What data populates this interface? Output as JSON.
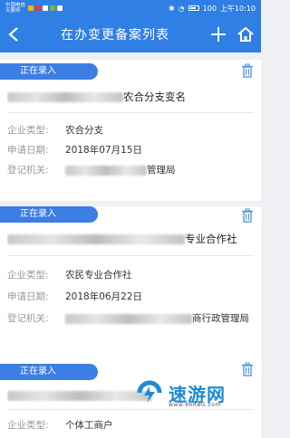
{
  "status_bar": {
    "carrier_line1": "中国电信",
    "carrier_line2": "天服务",
    "battery": "100",
    "time": "上午10:10"
  },
  "nav": {
    "back_icon": "chevron-left-icon",
    "title": "在办变更备案列表",
    "add_icon": "plus-icon",
    "home_icon": "home-icon"
  },
  "cards": [
    {
      "status": "正在录入",
      "name_visible": "农合分支变名",
      "rows": [
        {
          "label": "企业类型:",
          "value": "农合分支"
        },
        {
          "label": "申请日期:",
          "value": "2018年07月15日"
        },
        {
          "label": "登记机关:",
          "value": "管理局"
        }
      ]
    },
    {
      "status": "正在录入",
      "name_visible": "专业合作社",
      "rows": [
        {
          "label": "企业类型:",
          "value": "农民专业合作社"
        },
        {
          "label": "申请日期:",
          "value": "2018年06月22日"
        },
        {
          "label": "登记机关:",
          "value": "商行政管理局"
        }
      ]
    },
    {
      "status": "正在录入",
      "name_visible": "",
      "rows": [
        {
          "label": "企业类型:",
          "value": "个体工商户"
        }
      ]
    }
  ],
  "watermark": {
    "text": "速游网",
    "url": "www.86RBG.com"
  },
  "colors": {
    "primary": "#2f7fe4",
    "badge": "#3d7ee4",
    "trash": "#4a90e2"
  }
}
